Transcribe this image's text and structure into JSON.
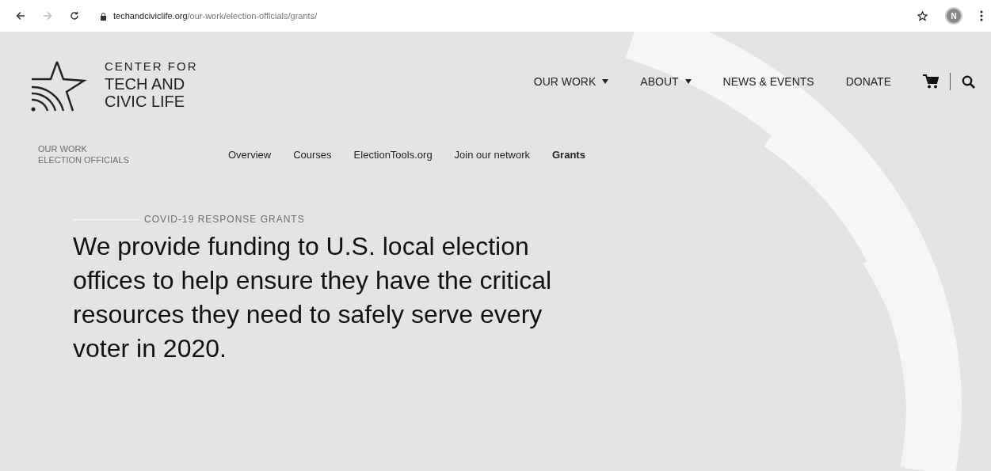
{
  "browser": {
    "url_domain": "techandciviclife.org",
    "url_path": "/our-work/election-officials/grants/",
    "avatar_letter": "N"
  },
  "logo": {
    "line_1": "CENTER FOR",
    "line_2": "TECH AND",
    "line_3": "CIVIC LIFE"
  },
  "main_nav": [
    {
      "label": "OUR WORK",
      "dropdown": true
    },
    {
      "label": "ABOUT",
      "dropdown": true
    },
    {
      "label": "NEWS & EVENTS",
      "dropdown": false
    },
    {
      "label": "DONATE",
      "dropdown": false
    }
  ],
  "section_label": {
    "line_1": "OUR WORK",
    "line_2": "ELECTION OFFICIALS"
  },
  "sub_nav": [
    {
      "label": "Overview",
      "selected": false
    },
    {
      "label": "Courses",
      "selected": false
    },
    {
      "label": "ElectionTools.org",
      "selected": false
    },
    {
      "label": "Join our network",
      "selected": false
    },
    {
      "label": "Grants",
      "selected": true
    }
  ],
  "hero": {
    "eyebrow": "COVID-19 RESPONSE GRANTS",
    "headline": "We provide funding to U.S. local election offices to help ensure they have the critical resources they need to safely serve every voter in 2020."
  }
}
